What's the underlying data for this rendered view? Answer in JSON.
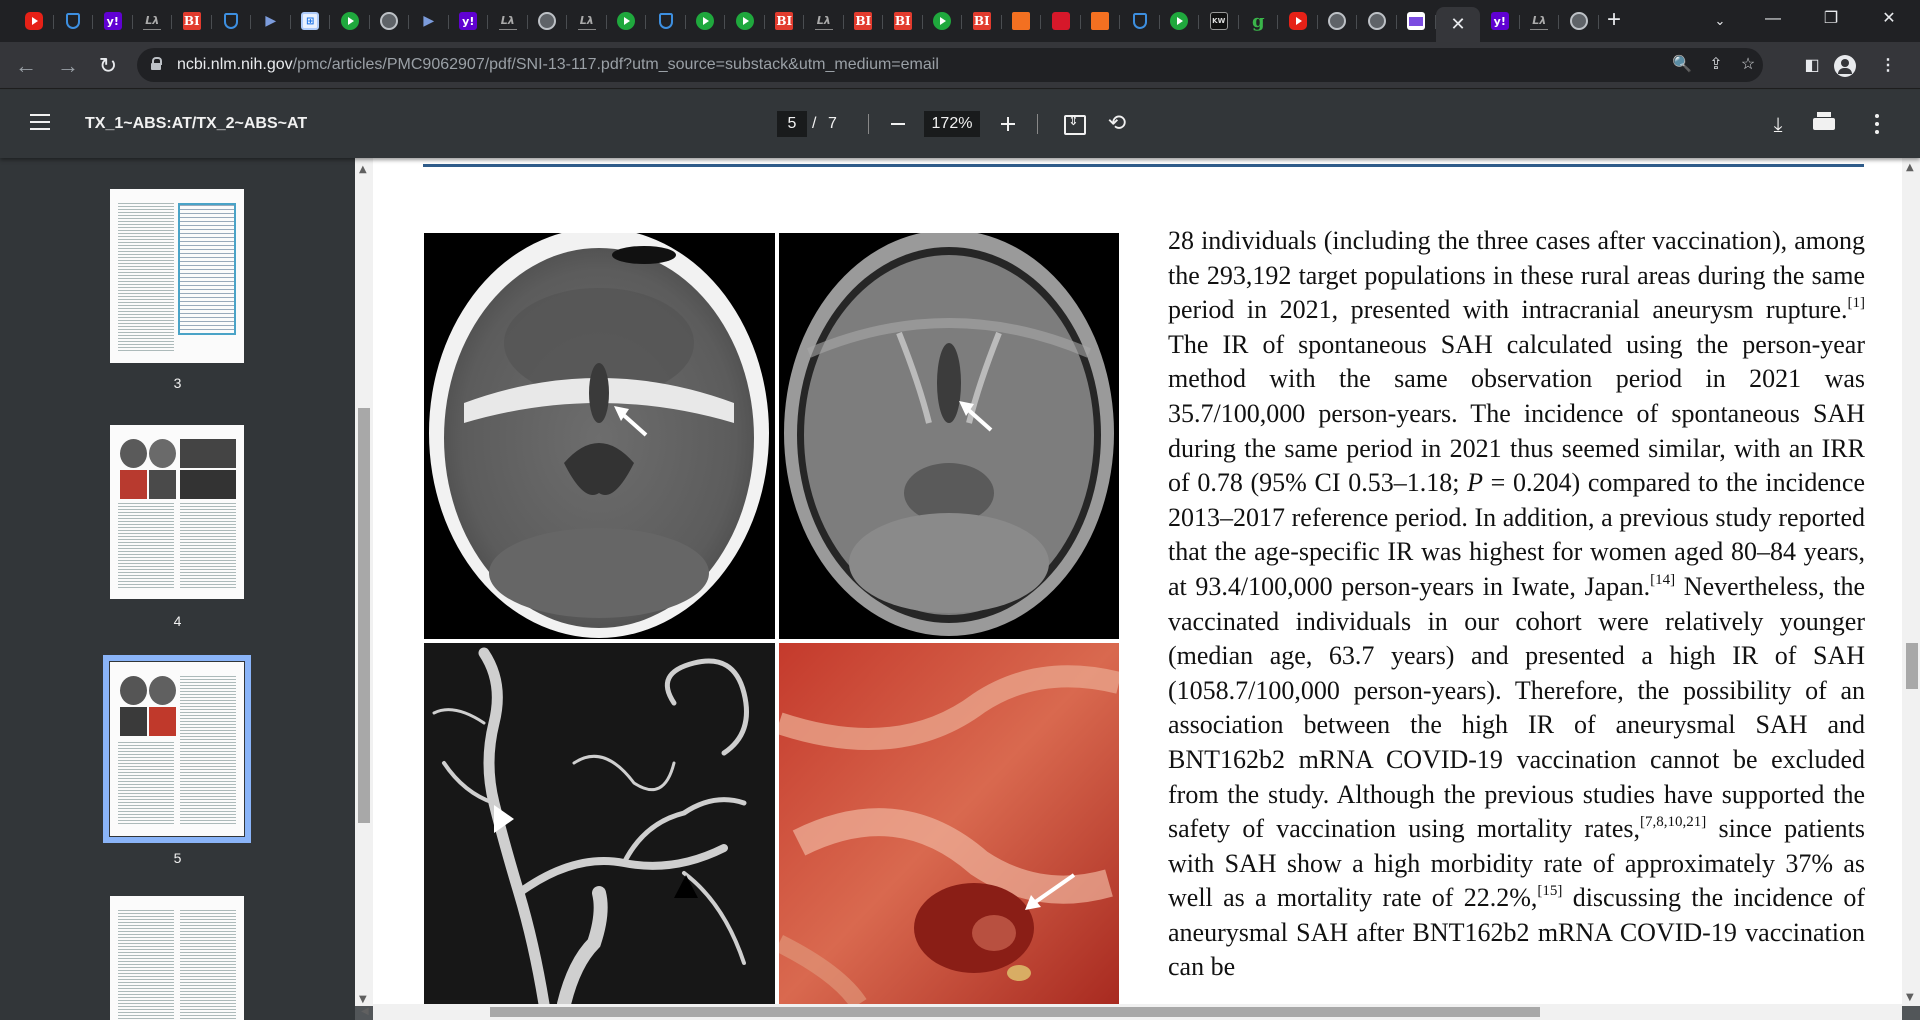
{
  "browser": {
    "tabs": [
      "youtube",
      "shield",
      "yahoo",
      "la",
      "bi",
      "shield",
      "arrows",
      "sheet",
      "play",
      "globe",
      "arrows",
      "yahoo",
      "la",
      "globe",
      "la",
      "play",
      "shield",
      "play",
      "play",
      "bi",
      "la",
      "bi",
      "bi",
      "play",
      "bi",
      "bars",
      "redrow",
      "bars",
      "shield",
      "play",
      "kw",
      "g",
      "youtube",
      "globe",
      "globe",
      "mail",
      "active",
      "yahoo",
      "la",
      "globe"
    ],
    "tab_labels": {
      "yahoo": "y!",
      "la": "Lλ",
      "bi": "BI",
      "sheet": "⊞",
      "arrows": "▶",
      "g": "g",
      "kw": "KW"
    },
    "active_tab_close": "✕",
    "new_tab": "+",
    "tab_search": "⌄",
    "window_controls": {
      "minimize": "—",
      "maximize": "❐",
      "close": "✕"
    },
    "url_host": "ncbi.nlm.nih.gov",
    "url_path": "/pmc/articles/PMC9062907/pdf/SNI-13-117.pdf?utm_source=substack&utm_medium=email",
    "nav": {
      "back": "←",
      "forward": "→",
      "reload": "↻"
    },
    "omnibox_icons": {
      "zoom": "🔍",
      "share": "⇪",
      "bookmark": "☆"
    },
    "toolbar_icons": {
      "sidebar": "◧"
    }
  },
  "pdf_toolbar": {
    "title": "TX_1~ABS:AT/TX_2~ABS~AT",
    "current_page": "5",
    "page_separator": "/",
    "total_pages": "7",
    "zoom": "172%",
    "rotate_glyph": "⟲",
    "download_glyph": "⤓"
  },
  "sidebar": {
    "thumbnails": [
      {
        "label": "3",
        "selected": false
      },
      {
        "label": "4",
        "selected": false
      },
      {
        "label": "5",
        "selected": true
      },
      {
        "label": "",
        "selected": false
      }
    ]
  },
  "page": {
    "figure_annotations": {
      "ct_arrow": "white arrow",
      "mri_arrow": "white arrow",
      "angio_arrowheads": [
        "white arrowhead",
        "black arrowhead"
      ],
      "surgery_arrow": "white arrow"
    },
    "paragraph": [
      {
        "t": "28 individuals (including the three cases after vaccination), among the 293,192 target populations in these rural areas during the same period in 2021, presented with intracranial aneurysm rupture."
      },
      {
        "sup": "[1]"
      },
      {
        "t": " The IR of spontaneous SAH calculated using the person-year method with the same observation period in 2021 was 35.7/100,000 person-years. The incidence of spontaneous SAH during the same period in 2021 thus seemed similar, with an IRR of 0.78 (95% CI 0.53–1.18; "
      },
      {
        "i": "P"
      },
      {
        "t": " = 0.204) compared to the incidence 2013–2017 reference period. In addition, a previous study reported that the age-specific IR was highest for women aged 80–84 years, at 93.4/100,000 person-years in Iwate, Japan."
      },
      {
        "sup": "[14]"
      },
      {
        "t": " Nevertheless, the vaccinated individuals in our cohort were relatively younger (median age, 63.7 years) and presented a high IR of SAH (1058.7/100,000 person-years). Therefore, the possibility of an association between the high IR of aneurysmal SAH and BNT162b2 mRNA COVID-19 vaccination cannot be excluded from the study. Although the previous studies have supported the safety of vaccination using mortality rates,"
      },
      {
        "sup": "[7,8,10,21]"
      },
      {
        "t": " since patients with SAH show a high morbidity rate of approximately 37% as well as a mortality rate of 22.2%,"
      },
      {
        "sup": "[15]"
      },
      {
        "t": " discussing the incidence of aneurysmal SAH after BNT162b2 mRNA COVID-19 vaccination can be"
      }
    ]
  },
  "colors": {
    "tab_strip": "#202124",
    "toolbar": "#35363a",
    "pdf_toolbar": "#323639",
    "viewer_bg": "#525659",
    "selected_thumb": "#8ab4f8",
    "page_rule": "#2f5c8a"
  }
}
